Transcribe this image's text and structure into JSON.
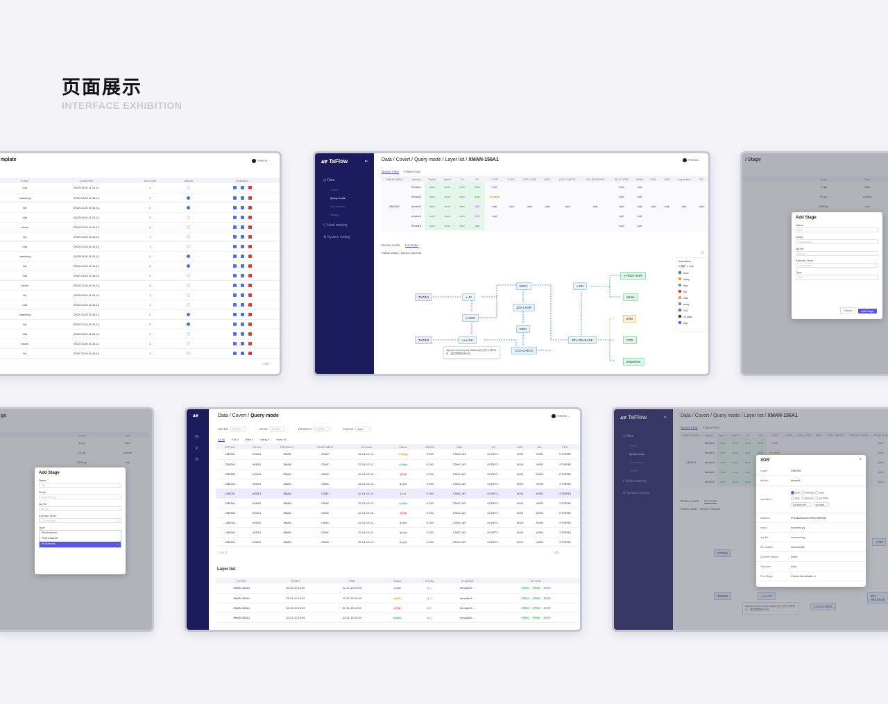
{
  "header": {
    "title": "页面展示",
    "subtitle": "INTERFACE EXHIBITION"
  },
  "common": {
    "app_name": "TaFlow",
    "user": "P00006",
    "collapse_icon": "collapse-icon"
  },
  "panel1": {
    "title": "mplate",
    "columns": [
      "author",
      "createTime",
      "flow count",
      "default",
      "Operation"
    ],
    "rows": [
      [
        "root",
        "2022-03-26 11:31:12",
        "1",
        "off"
      ],
      [
        "xiaoming",
        "2022-03-26 11:31:12",
        "2",
        "on"
      ],
      [
        "liai",
        "2022-03-26 11:31:12",
        "2",
        "on"
      ],
      [
        "hha",
        "2022-03-26 11:31:12",
        "3",
        "off"
      ],
      [
        "niuum",
        "2022-03-26 11:31:12",
        "4",
        "off"
      ],
      [
        "lily",
        "2022-03-26 11:31:12",
        "1",
        "off"
      ],
      [
        "root",
        "2022-03-26 11:31:12",
        "1",
        "off"
      ],
      [
        "xiaoming",
        "2022-03-26 11:31:12",
        "2",
        "on"
      ],
      [
        "liai",
        "2022-03-26 11:31:12",
        "2",
        "on"
      ],
      [
        "hha",
        "2022-03-26 11:31:12",
        "3",
        "off"
      ],
      [
        "niuum",
        "2022-03-26 11:31:12",
        "4",
        "off"
      ],
      [
        "lily",
        "2022-03-26 11:31:12",
        "1",
        "off"
      ],
      [
        "root",
        "2022-03-26 11:31:12",
        "1",
        "off"
      ],
      [
        "xiaoming",
        "2022-03-26 11:31:12",
        "2",
        "on"
      ],
      [
        "liai",
        "2022-03-26 11:31:12",
        "2",
        "on"
      ],
      [
        "hha",
        "2022-03-26 11:31:12",
        "3",
        "off"
      ],
      [
        "niuum",
        "2022-03-26 11:31:12",
        "4",
        "off"
      ],
      [
        "lily",
        "2022-03-26 11:31:12",
        "1",
        "off"
      ]
    ],
    "pager": "1/2"
  },
  "panel2": {
    "breadcrumb": "Data / Covert / Query mode / Layer list / ",
    "breadcrumb_bold": "XMAN-156A1",
    "nav": {
      "data": "Data",
      "covert": "Covert",
      "query": "Query mode",
      "job": "Job monitor",
      "setting": "Setting",
      "mask": "Mask making",
      "system": "System setting"
    },
    "tabs": [
      "Device Flow",
      "Frame Flow"
    ],
    "columns": [
      "XMAN-156A1",
      "device",
      "Tapin1",
      "Tapin2",
      "JV",
      "CK",
      "XOR",
      "EJDV",
      "JDV LXOR",
      "MRC",
      "CCD CHECK",
      "JDV RELEASE",
      "PDJV XOR",
      "Writer",
      "CCD",
      "ZND",
      "Inspection",
      "PD"
    ],
    "lot": "CM0301",
    "devices": [
      {
        "name": "device1",
        "cells": [
          "done",
          "done",
          "done",
          "done",
          "OrG",
          "",
          "",
          "",
          "",
          "",
          "wait",
          "wait",
          "",
          "",
          "",
          ""
        ]
      },
      {
        "name": "device2",
        "cells": [
          "done",
          "done",
          "done",
          "done",
          "no clean",
          "",
          "",
          "",
          "",
          "",
          "wait",
          "wait",
          "",
          "",
          "",
          ""
        ]
      },
      {
        "name": "device3",
        "cells": [
          "done",
          "done",
          "done",
          "OrG",
          "wait",
          "wait",
          "wait",
          "wait",
          "wait",
          "wait",
          "wait",
          "wait",
          "wait",
          "wait",
          "skip",
          "wait"
        ]
      },
      {
        "name": "device4",
        "cells": [
          "done",
          "done",
          "done",
          "OrG",
          "wait",
          "",
          "",
          "",
          "",
          "",
          "wait",
          "wait",
          "",
          "",
          "",
          ""
        ]
      },
      {
        "name": "device5",
        "cells": [
          "done",
          "done",
          "done",
          "wait",
          "",
          "",
          "",
          "",
          "",
          "",
          "wait",
          "wait",
          "",
          "",
          "",
          ""
        ]
      }
    ],
    "mode_tabs": [
      "Device mode",
      "Lot mode"
    ],
    "sub_crumb": "XMAN-156A1 / Device / Device1",
    "nodes": {
      "tapin1": "TAPIN1",
      "tapin2": "TAPIN2",
      "jv": "JV",
      "xor": "XOR",
      "ck": "CK",
      "ejdv": "EJDV",
      "jdvlxor": "JDV LXOR",
      "mrc": "MRC",
      "ccdcheck": "CCD CHECK",
      "jdvrelease": "JDV RELEASE",
      "pd": "PD",
      "pdjvxor": "PDJV XOR",
      "writer": "Writer",
      "znd": "ZND",
      "ccd": "CCD",
      "inspection": "Inspection"
    },
    "tooltip": "layer[xxx],device[xxx],state[xxx]已执行2小时30分，超过预期时间30分",
    "legend_title": "Instructions",
    "legend_top": [
      "操作",
      "Link"
    ],
    "legend": [
      {
        "label": "done",
        "color": "#2e9a5d"
      },
      {
        "label": "doing",
        "color": "#e49b2b"
      },
      {
        "label": "wait",
        "color": "#888"
      },
      {
        "label": "fail",
        "color": "#d43b3b"
      },
      {
        "label": "hold",
        "color": "#f2a43a"
      },
      {
        "label": "ready",
        "color": "#4a90e2"
      },
      {
        "label": "OrG",
        "color": "#8b4cd4"
      },
      {
        "label": "no clean",
        "color": "#333"
      },
      {
        "label": "skip",
        "color": "#4a6cf0"
      }
    ]
  },
  "panel3": {
    "title": "/ Stage",
    "columns": [
      "Script",
      "Type"
    ],
    "rows": [
      [
        "JV.py",
        "Start"
      ],
      [
        "CK.py",
        "normal"
      ],
      [
        "XOR.py",
        "end"
      ]
    ],
    "modal": {
      "title": "Add Stage",
      "name_label": "Name",
      "name_ph": "JDV",
      "script_label": "Script",
      "script_ph": "/mask/JDC.py",
      "log_label": "log file",
      "log_ph": "sec.log",
      "exec_label": "Execute Level",
      "exec_ph": "One instance",
      "type_label": "Type",
      "type_ph": "start",
      "cancel": "Cancel",
      "confirm": "Add Stage"
    }
  },
  "panel4": {
    "title": "ge",
    "rows": [
      [
        "JV.py",
        "Start"
      ],
      [
        "CK.py",
        "normal"
      ],
      [
        "XOR.py",
        "end"
      ]
    ],
    "modal": {
      "title": "Add Stage",
      "name_label": "Name",
      "name_ph": "JDV",
      "script_label": "Script",
      "script_ph": "/mask/JDC.py",
      "log_label": "log file",
      "log_ph": "sec.log",
      "exec_label": "Execute Level",
      "exec_ph": "One instance",
      "type_label": "Type",
      "options": [
        "One Instance",
        "Plow Instance",
        "All Instance"
      ]
    }
  },
  "panel5": {
    "breadcrumb": "Data / Covert / ",
    "breadcrumb_bold": "Query mode",
    "filters": {
      "crt": "CRT.NO",
      "srno": "SR.NO",
      "product": "PRODUCT",
      "status": "STATUS",
      "input_ph": "请只输入",
      "status_val": "done"
    },
    "status_tabs": [
      "All 16",
      "Fail 4",
      "Wait 4",
      "doing 2",
      "done 16"
    ],
    "columns": [
      "CRT.NO",
      "SR.NO",
      "PRODUCT",
      "CUSTOMER",
      "Bin Date",
      "Status",
      "DS026",
      "FAB",
      "MT",
      "SIZE",
      "ALL",
      "PRO"
    ],
    "rows": [
      [
        "CM0301",
        "M0301",
        "XMAN",
        "CSMC",
        "22-01-10 10...",
        "doing",
        "0.250",
        "CSMC-W2",
        "4X RETI...",
        "6025",
        "NSW",
        "OTHERS"
      ],
      [
        "CM0301",
        "M0301",
        "XMAN",
        "CSMC",
        "22-01-10 10...",
        "done",
        "0.250",
        "CSMC-W2",
        "4X RETI...",
        "6025",
        "NSW",
        "OTHERS"
      ],
      [
        "CM0301",
        "M0301",
        "XMAN",
        "CSMC",
        "22-01-10 10...",
        "Fail",
        "0.250",
        "CSMC-W2",
        "4X RETI...",
        "6025",
        "NSW",
        "OTHERS"
      ],
      [
        "CM0301",
        "M0301",
        "XMAN",
        "CSMC",
        "22-01-10 10...",
        "wait",
        "0.250",
        "CSMC-W2",
        "4X RETI...",
        "6025",
        "NSW",
        "OTHERS"
      ],
      [
        "CM0301",
        "M0301",
        "XMAN",
        "CSMC",
        "22-01-10 10...",
        "wait",
        "0.250",
        "CSMC-W2",
        "4X RETI...",
        "6025",
        "NSW",
        "OTHERS"
      ],
      [
        "CM0301",
        "M0301",
        "XMAN",
        "CSMC",
        "22-01-10 10...",
        "done",
        "0.250",
        "CSMC-W2",
        "4X RETI...",
        "6025",
        "NSW",
        "OTHERS"
      ],
      [
        "CM0301",
        "M0301",
        "XMAN",
        "CSMC",
        "22-01-10 10...",
        "Fail",
        "0.250",
        "CSMC-W2",
        "4X RETI...",
        "6025",
        "NSW",
        "OTHERS"
      ],
      [
        "CM0301",
        "M0301",
        "XMAN",
        "CSMC",
        "22-01-10 10...",
        "wait",
        "0.250",
        "CSMC-W2",
        "4X RETI...",
        "6025",
        "NSW",
        "OTHERS"
      ],
      [
        "CM0301",
        "M0301",
        "XMAN",
        "CSMC",
        "22-01-10 10...",
        "wait",
        "0.250",
        "CSMC-W2",
        "4X RETI...",
        "6025",
        "NSW",
        "OTHERS"
      ],
      [
        "CM0301",
        "M0301",
        "XMAN",
        "CSMC",
        "22-01-10 10...",
        "wait",
        "0.250",
        "CSMC-W2",
        "4X RETI...",
        "6025",
        "NSW",
        "OTHERS"
      ]
    ],
    "count": "1-8 of 27",
    "layer_title": "Layer list",
    "layer_columns": [
      "LAYER",
      "START",
      "END",
      "Status",
      "Priority",
      "template1",
      "ACTION"
    ],
    "layers": [
      [
        "XMAN-156A1",
        "22-01-10 10:09",
        "22-01-10 10:09",
        "wait",
        "1",
        "template1"
      ],
      [
        "XMAN-156A1",
        "22-01-10 10:09",
        "22-01-10 10:09",
        "OrG",
        "1",
        "template1"
      ],
      [
        "XMAN-156A1",
        "22-01-10 10:09",
        "22-01-10 10:09",
        "Fail",
        "1",
        "template1"
      ],
      [
        "XMAN-156A1",
        "22-01-10 10:09",
        "22-01-10 10:09",
        "done",
        "1",
        "template1"
      ]
    ],
    "actions": [
      "TIPIN1",
      "TIPIN2",
      "STOP"
    ]
  },
  "panel6": {
    "breadcrumb": "Data / Covert / Query mode / Layer list / ",
    "breadcrumb_bold": "XMAN-156A1",
    "modal": {
      "title": "XOR",
      "fields": [
        [
          "Layer",
          "CM0301"
        ],
        [
          "device",
          "device1"
        ],
        [
          "location",
          "/Product/source/RG/CM0301"
        ],
        [
          "script",
          "xxxx/xxx.py"
        ],
        [
          "log file",
          "xxxxxxx.log"
        ],
        [
          "File-Name",
          "xxxxxxx.00"
        ],
        [
          "Current Status",
          "Done"
        ],
        [
          "Operater",
          "Auto"
        ],
        [
          "Pre-Stage",
          "Check the details >>"
        ]
      ],
      "operation_label": "operation",
      "op_row1": [
        "hold",
        "Release",
        "skip"
      ],
      "op_row2": [
        "stop",
        "Rework",
        "set finish"
      ],
      "op_selects": [
        "Exclude self",
        "success"
      ]
    },
    "nodes": {
      "tapin1": "TAPIN1",
      "tapin2": "TAPIN2",
      "ck": "CK",
      "ccdcheck": "CCD CHECK",
      "jdvrelease": "JDV RELEASE",
      "pd": "PD"
    },
    "tooltip": "layer[xxx],device[xxx],state[xxx]已执行2小时30分，超过预期时间30分"
  }
}
